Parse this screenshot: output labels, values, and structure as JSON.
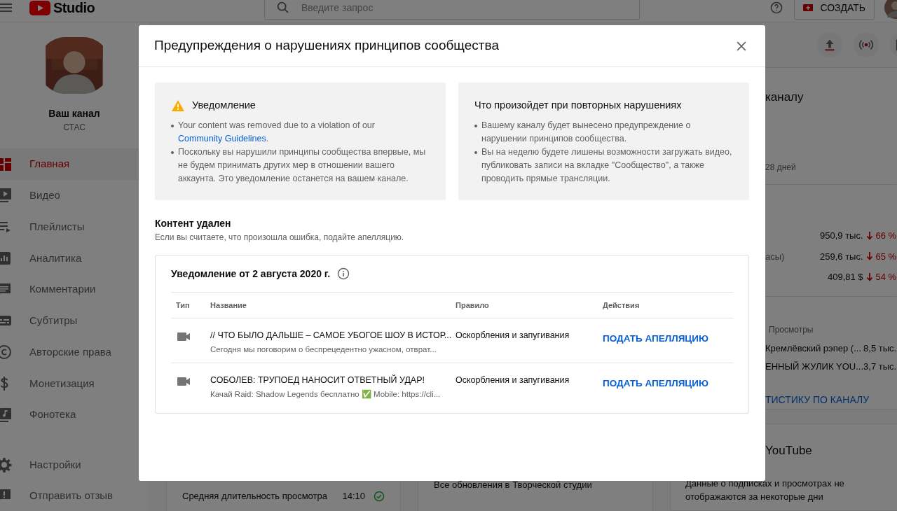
{
  "header": {
    "logo_text": "Studio",
    "search": {
      "placeholder": "Введите запрос"
    },
    "create_button": "СОЗДАТЬ"
  },
  "sidebar": {
    "channel_label": "Ваш канал",
    "channel_name": "СТАС",
    "items": [
      {
        "label": "Главная",
        "selected": true
      },
      {
        "label": "Видео",
        "selected": false
      },
      {
        "label": "Плейлисты",
        "selected": false
      },
      {
        "label": "Аналитика",
        "selected": false
      },
      {
        "label": "Комментарии",
        "selected": false
      },
      {
        "label": "Субтитры",
        "selected": false
      },
      {
        "label": "Авторские права",
        "selected": false
      },
      {
        "label": "Монетизация",
        "selected": false
      },
      {
        "label": "Фонотека",
        "selected": false
      }
    ],
    "bottom_items": [
      {
        "label": "Настройки"
      },
      {
        "label": "Отправить отзыв"
      }
    ]
  },
  "analytics_card": {
    "title": "каналу",
    "period": "28 дней",
    "metrics": [
      {
        "value": "950,9 тыс.",
        "change": "66 %"
      },
      {
        "label": "асы)",
        "value": "259,6 тыс.",
        "change": "65 %"
      },
      {
        "value": "409,81 $",
        "change": "54 %"
      }
    ],
    "top_videos": {
      "column": "Просмотры",
      "rows": [
        {
          "title": "Кремлёвский рэпер (...",
          "views": "8,5 тыс."
        },
        {
          "title": "ЕННЫЙ ЖУЛИК YOU...",
          "views": "3,7 тыс."
        }
      ]
    },
    "link": "ТИСТИКУ ПО КАНАЛУ"
  },
  "news_card": {
    "title": "YouTube",
    "text": "Данные о подписках и просмотрах не отображаются за некоторые дни"
  },
  "bottom_cards": [
    {
      "label": "Средняя длительность просмотра",
      "value": "14:10"
    },
    {
      "label": "Все обновления в Творческой студии"
    }
  ],
  "dialog": {
    "title": "Предупреждения о нарушениях принципов сообщества",
    "notice": {
      "heading": "Уведомление",
      "bullets": [
        {
          "text": "Your content was removed due to a violation of our",
          "link": "Community Guidelines",
          "after": "."
        },
        {
          "text": "Поскольку вы нарушили принципы сообщества впервые, мы не будем принимать других мер в отношении вашего аккаунта. Это уведомление останется на вашем канале."
        }
      ]
    },
    "consequences": {
      "heading": "Что произойдет при повторных нарушениях",
      "bullets": [
        {
          "text": "Вашему каналу будет вынесено предупреждение о нарушении принципов сообщества."
        },
        {
          "text": "Вы на неделю будете лишены возможности загружать видео, публиковать записи на вкладке \"Сообщество\", а также проводить прямые трансляции."
        }
      ]
    },
    "section": {
      "heading": "Контент удален",
      "subtitle": "Если вы считаете, что произошла ошибка, подайте апелляцию."
    },
    "strike": {
      "title": "Уведомление от 2 августа 2020 г.",
      "columns": [
        "Тип",
        "Название",
        "Правило",
        "Действия"
      ],
      "rows": [
        {
          "title": "// ЧТО БЫЛО ДАЛЬШЕ – САМОЕ УБОГОЕ ШОУ В ИСТОР...",
          "description": "Сегодня мы поговорим о беспрецедентно ужасном, отврат...",
          "rule": "Оскорбления и запугивания",
          "action": "ПОДАТЬ АПЕЛЛЯЦИЮ"
        },
        {
          "title": "СОБОЛЕВ: ТРУПОЕД НАНОСИТ ОТВЕТНЫЙ УДАР!",
          "description": "Качай Raid: Shadow Legends бесплатно ✅ Mobile: https://cli...",
          "rule": "Оскорбления и запугивания",
          "action": "ПОДАТЬ АПЕЛЛЯЦИЮ"
        }
      ]
    }
  }
}
